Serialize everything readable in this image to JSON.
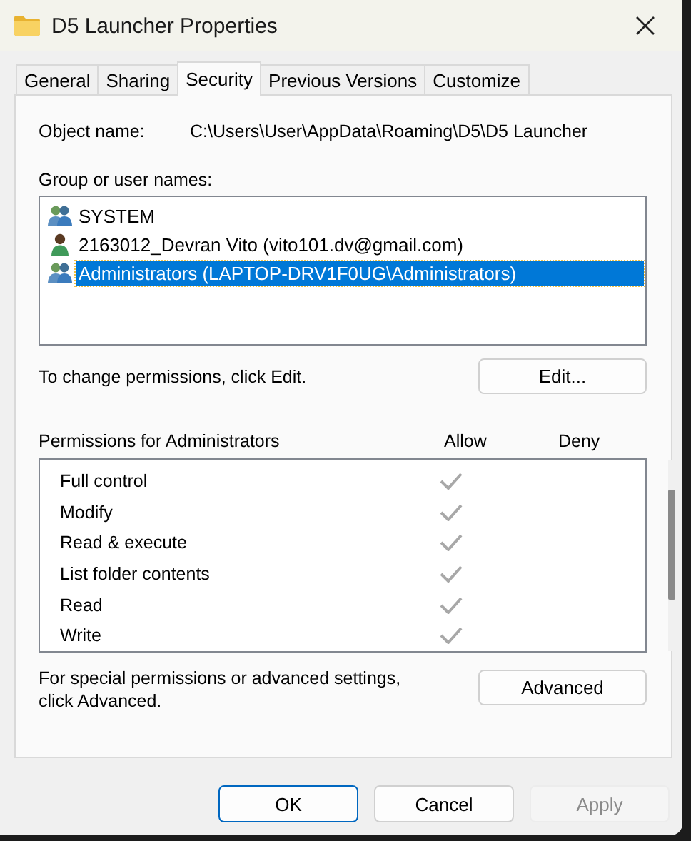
{
  "window": {
    "title": "D5 Launcher Properties"
  },
  "tabs": [
    {
      "label": "General",
      "selected": false
    },
    {
      "label": "Sharing",
      "selected": false
    },
    {
      "label": "Security",
      "selected": true
    },
    {
      "label": "Previous Versions",
      "selected": false
    },
    {
      "label": "Customize",
      "selected": false
    }
  ],
  "object_name": {
    "label": "Object name:",
    "value": "C:\\Users\\User\\AppData\\Roaming\\D5\\D5 Launcher"
  },
  "users": {
    "label": "Group or user names:",
    "items": [
      {
        "kind": "group",
        "name": "SYSTEM",
        "selected": false
      },
      {
        "kind": "user",
        "name": "2163012_Devran Vito (vito101.dv@gmail.com)",
        "selected": false
      },
      {
        "kind": "group",
        "name": "Administrators (LAPTOP-DRV1F0UG\\Administrators)",
        "selected": true
      }
    ]
  },
  "edit_hint": "To change permissions, click Edit.",
  "edit_button": "Edit...",
  "permissions": {
    "label": "Permissions for Administrators",
    "columns": [
      "Allow",
      "Deny"
    ],
    "rows": [
      {
        "name": "Full control",
        "allow": true,
        "deny": false
      },
      {
        "name": "Modify",
        "allow": true,
        "deny": false
      },
      {
        "name": "Read & execute",
        "allow": true,
        "deny": false
      },
      {
        "name": "List folder contents",
        "allow": true,
        "deny": false
      },
      {
        "name": "Read",
        "allow": true,
        "deny": false
      },
      {
        "name": "Write",
        "allow": true,
        "deny": false
      }
    ]
  },
  "advanced_hint": "For special permissions or advanced settings, click Advanced.",
  "advanced_button": "Advanced",
  "buttons": [
    {
      "label": "OK",
      "kind": "default",
      "disabled": false
    },
    {
      "label": "Cancel",
      "kind": "normal",
      "disabled": false
    },
    {
      "label": "Apply",
      "kind": "normal",
      "disabled": true
    }
  ]
}
